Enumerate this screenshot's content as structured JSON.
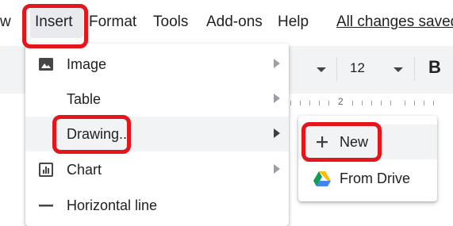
{
  "menubar": {
    "cut_item": "w",
    "items": [
      "Insert",
      "Format",
      "Tools",
      "Add-ons",
      "Help"
    ],
    "status": "All changes saved"
  },
  "toolbar": {
    "font_size": "12",
    "bold_label": "B"
  },
  "ruler": {
    "label": "2"
  },
  "insert_menu": {
    "items": [
      {
        "label": "Image",
        "icon": "image-icon",
        "has_submenu": true
      },
      {
        "label": "Table",
        "icon": "",
        "has_submenu": true
      },
      {
        "label": "Drawing...",
        "icon": "",
        "has_submenu": true
      },
      {
        "label": "Chart",
        "icon": "chart-icon",
        "has_submenu": true
      },
      {
        "label": "Horizontal line",
        "icon": "horizontal-line-icon",
        "has_submenu": false
      }
    ]
  },
  "drawing_submenu": {
    "items": [
      {
        "label": "New",
        "icon": "plus-icon"
      },
      {
        "label": "From Drive",
        "icon": "google-drive-icon"
      }
    ]
  },
  "colors": {
    "highlight": "#e4151b",
    "hover_bg": "#f1f3f4",
    "text": "#202124"
  }
}
